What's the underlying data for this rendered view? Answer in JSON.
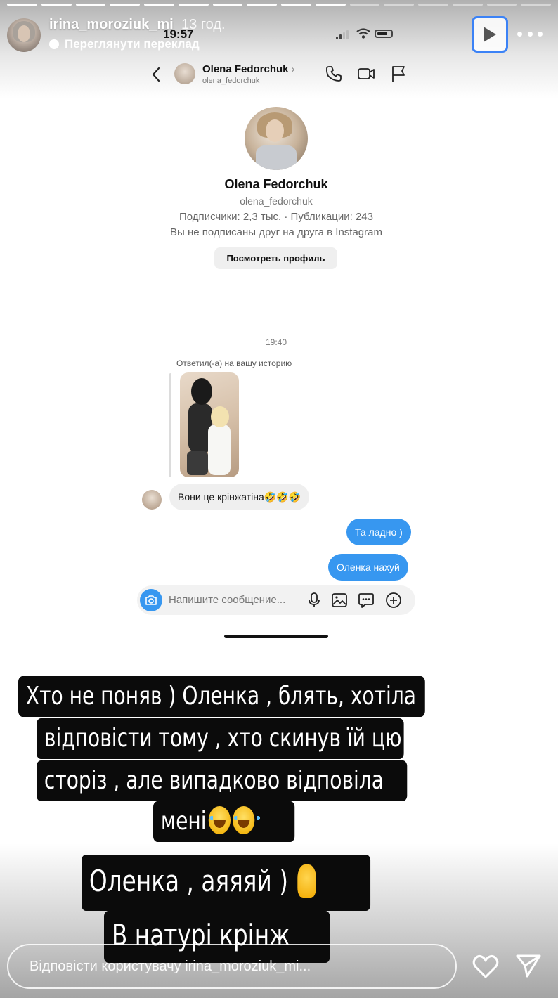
{
  "story": {
    "username": "irina_moroziuk_mi",
    "time_ago": "13 год.",
    "translate_label": "Переглянути переклад",
    "progress_total": 16,
    "progress_done": 10,
    "reply_placeholder": "Відповісти користувачу irina_moroziuk_mi..."
  },
  "phone_status": {
    "time": "19:57"
  },
  "dm": {
    "header_name": "Olena Fedorchuk",
    "header_handle": "olena_fedorchuk",
    "profile_name": "Olena Fedorchuk",
    "profile_handle": "olena_fedorchuk",
    "profile_stats": "Подписчики: 2,3 тыс. · Публикации: 243",
    "profile_follow_note": "Вы не подписаны друг на друга в Instagram",
    "view_profile_label": "Посмотреть профиль",
    "message_time": "19:40",
    "reply_note": "Ответил(-а) на вашу историю",
    "incoming_message": "Вони це крінжатіна🤣🤣🤣",
    "outgoing_messages": [
      "Та ладно )",
      "Оленка нахуй"
    ],
    "composer_placeholder": "Напишите сообщение..."
  },
  "captions": {
    "line1": "Хто не поняв ) Оленка , блять, хотіла",
    "line2": "відповісти тому , хто скинув їй цю",
    "line3": "сторіз , але випадково відповіла",
    "line4": "мені",
    "line5": "Оленка , аяяяй )",
    "line6": "В натурі крінж"
  },
  "icons": {
    "story_play": "play-icon",
    "story_more": "more-icon",
    "dm_back": "chevron-left-icon",
    "dm_call": "phone-icon",
    "dm_video": "video-icon",
    "dm_flag": "flag-icon",
    "composer_camera": "camera-icon",
    "composer_mic": "microphone-icon",
    "composer_gallery": "image-icon",
    "composer_sticker": "sticker-icon",
    "composer_add": "plus-circle-icon",
    "reply_like": "heart-icon",
    "reply_send": "send-icon"
  },
  "colors": {
    "outgoing_bubble": "#3797f0",
    "incoming_bubble": "#efefef",
    "caption_bg": "#0b0b0b",
    "play_focus": "#3b82f6"
  }
}
